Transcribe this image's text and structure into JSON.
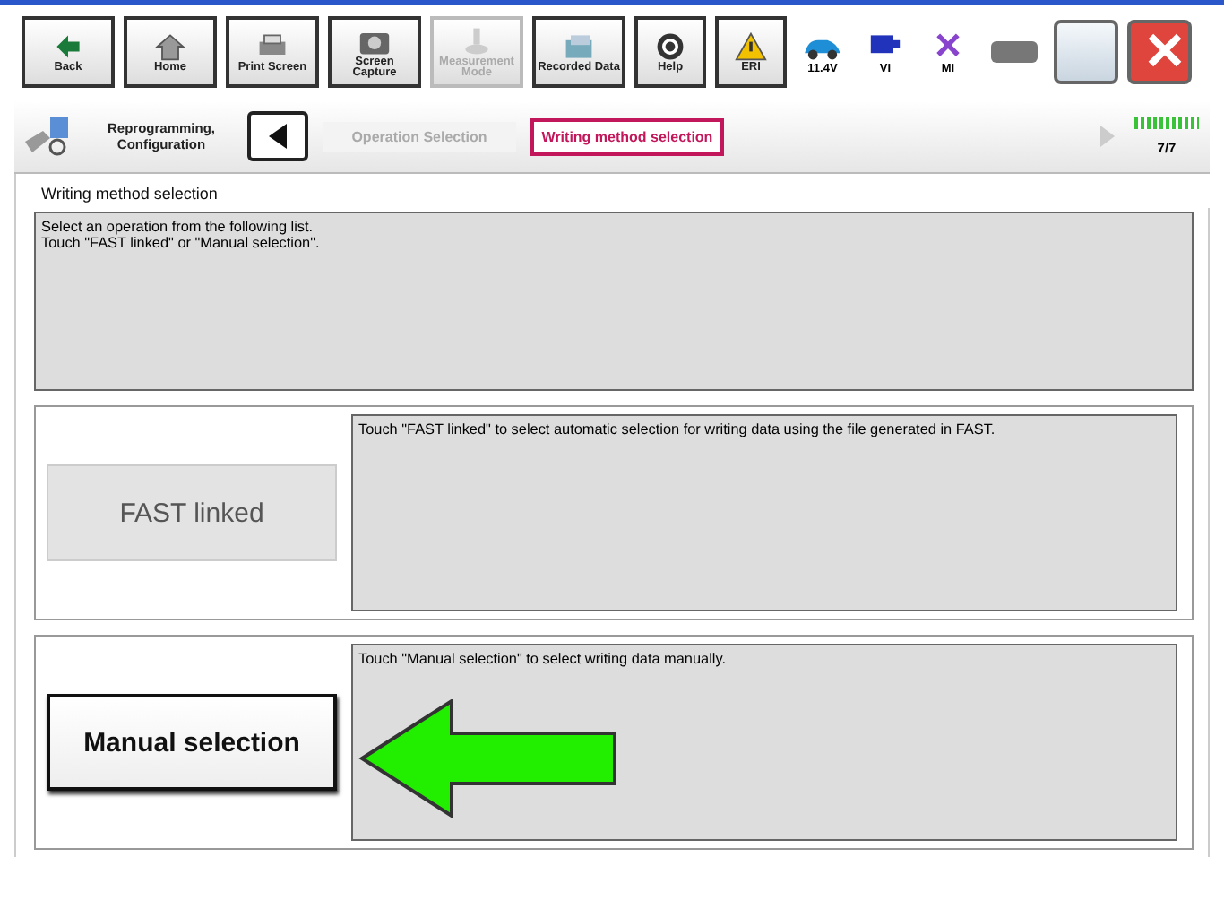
{
  "toolbar": {
    "buttons": [
      {
        "label": "Back",
        "disabled": false
      },
      {
        "label": "Home",
        "disabled": false
      },
      {
        "label": "Print Screen",
        "disabled": false
      },
      {
        "label": "Screen Capture",
        "disabled": false
      },
      {
        "label": "Measurement Mode",
        "disabled": true
      },
      {
        "label": "Recorded Data",
        "disabled": false
      },
      {
        "label": "Help",
        "disabled": false
      },
      {
        "label": "ERI",
        "disabled": false
      }
    ],
    "status": [
      {
        "label": "11.4V"
      },
      {
        "label": "VI"
      },
      {
        "label": "MI"
      }
    ]
  },
  "breadcrumb": {
    "section": "Reprogramming, Configuration",
    "steps": [
      {
        "label": "Operation Selection",
        "selected": false
      },
      {
        "label": "Writing method selection",
        "selected": true
      }
    ],
    "page": "7/7"
  },
  "heading": "Writing method selection",
  "instructions": [
    "Select an operation from the following list.",
    "Touch \"FAST linked\" or \"Manual selection\"."
  ],
  "options": [
    {
      "label": "FAST linked",
      "disabled": true,
      "description": "Touch \"FAST linked\" to select automatic selection for writing data using the file generated in FAST.",
      "pointed": false
    },
    {
      "label": "Manual selection",
      "disabled": false,
      "description": "Touch \"Manual selection\" to select writing data manually.",
      "pointed": true
    }
  ]
}
